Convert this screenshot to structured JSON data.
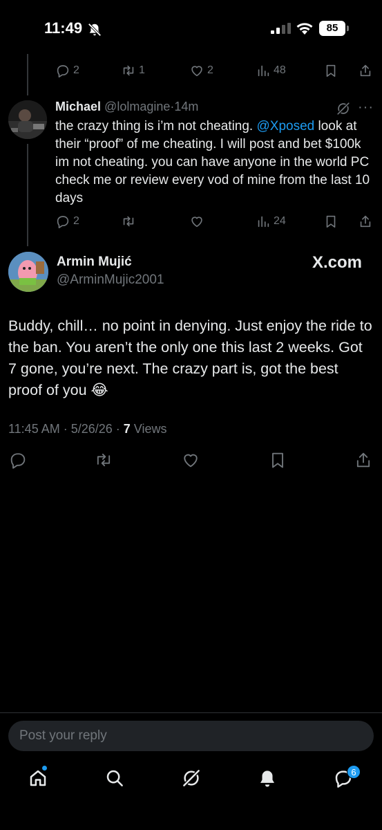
{
  "status_bar": {
    "time": "11:49",
    "battery": "85"
  },
  "parent_tweet": {
    "reply_count": "2",
    "retweet_count": "1",
    "like_count": "2",
    "view_count": "48"
  },
  "reply_tweet": {
    "name": "Michael",
    "handle": "@lolmagine",
    "separator": "·",
    "time_ago": "14m",
    "more": "···",
    "text_before": "the crazy thing is i’m not cheating. ",
    "mention": "@Xposed",
    "text_after": " look at their “proof” of me cheating. I will post and bet $100k im not cheating. you can have anyone in the world PC check me or review every vod of mine from the last 10 days",
    "reply_count": "2",
    "view_count": "24"
  },
  "main_tweet": {
    "name": "Armin Mujić",
    "handle": "@ArminMujic2001",
    "watermark": "X.com",
    "text": "Buddy, chill… no point in denying. Just enjoy the ride to the ban. You aren’t the only one this last 2 weeks. Got 7 gone, you’re next. The crazy part is, got the best proof of you 😂",
    "timestamp": "11:45 AM · 5/26/26 · ",
    "views_count": "7",
    "views_label": " Views"
  },
  "composer": {
    "placeholder": "Post your reply"
  },
  "bottom_nav": {
    "messages_badge": "6"
  },
  "colors": {
    "background": "#000000",
    "text_primary": "#e7e9ea",
    "text_secondary": "#71767b",
    "accent": "#1d9bf0"
  },
  "icons": [
    "bell-off-icon",
    "signal-icon",
    "wifi-icon",
    "reply-icon",
    "retweet-icon",
    "like-icon",
    "views-icon",
    "bookmark-icon",
    "share-icon",
    "grok-icon",
    "home-icon",
    "search-icon",
    "notifications-icon",
    "messages-icon"
  ]
}
